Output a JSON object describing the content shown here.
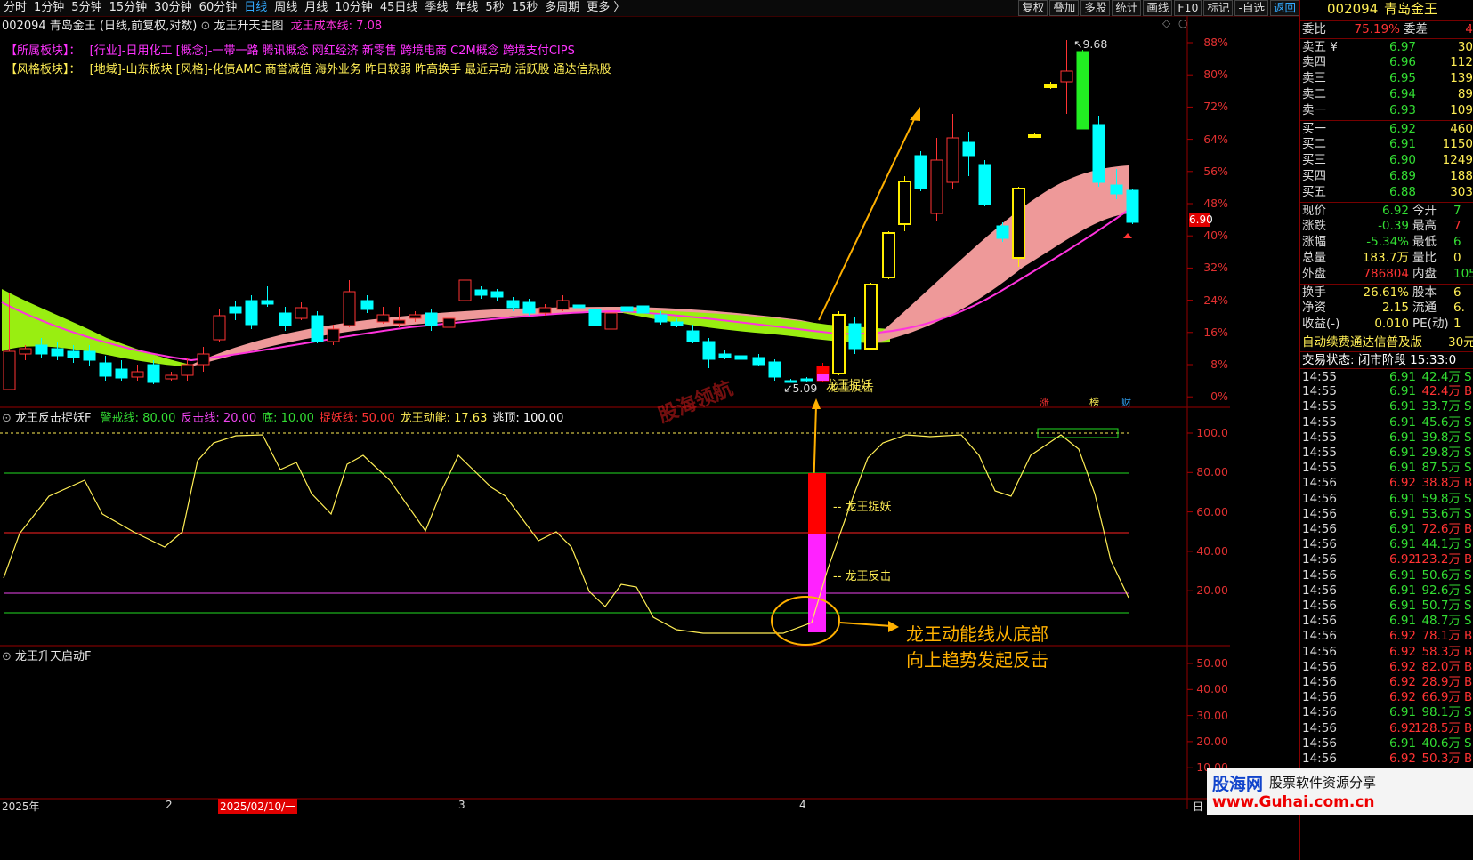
{
  "menubar": {
    "timeframes": [
      "分时",
      "1分钟",
      "5分钟",
      "15分钟",
      "30分钟",
      "60分钟",
      "日线",
      "周线",
      "月线",
      "10分钟",
      "45日线",
      "季线",
      "年线",
      "5秒",
      "15秒",
      "多周期",
      "更多 〉"
    ],
    "active_timeframe": "日线",
    "right_buttons": [
      "复权",
      "叠加",
      "多股",
      "统计",
      "画线",
      "F10",
      "标记",
      "-自选",
      "返回"
    ]
  },
  "main_chart": {
    "header_code": "002094 青岛金王 (日线,前复权,对数)",
    "indicator_name": "龙王升天主图",
    "cost_line_label": "龙王成本线: 7.08",
    "sector_label": "【所属板块】：",
    "sector_text": "[行业]-日用化工 [概念]-一带一路 腾讯概念 网红经济 新零售 跨境电商 C2M概念 跨境支付CIPS",
    "style_label": "【风格板块】：",
    "style_text": "[地域]-山东板块 [风格]-化债AMC 商誉减值 海外业务 昨日较弱 昨高换手 最近异动 活跃股 通达信热股",
    "y_axis": [
      "88%",
      "80%",
      "72%",
      "64%",
      "56%",
      "48%",
      "40%",
      "32%",
      "24%",
      "16%",
      "8%",
      "0%"
    ],
    "price_tag": "6.90",
    "high_label": "9.68",
    "low_label": "5.09",
    "signal_label": "龙王捉妖",
    "signal_label_2": "龙王反击",
    "bottom_badges": [
      "涨",
      "榜",
      "财"
    ]
  },
  "osc_panel": {
    "title": "龙王反击捉妖F",
    "params": [
      {
        "label": "警戒线: 80.00",
        "color": "#33dd33"
      },
      {
        "label": "反击线: 20.00",
        "color": "#ee44ee"
      },
      {
        "label": "底: 10.00",
        "color": "#33dd33"
      },
      {
        "label": "捉妖线: 50.00",
        "color": "#ff3333"
      },
      {
        "label": "龙王动能: 17.63",
        "color": "#ffee55"
      },
      {
        "label": "逃顶: 100.00",
        "color": "#ffffff"
      }
    ],
    "y_axis": [
      "100.0",
      "80.00",
      "60.00",
      "40.00",
      "20.00"
    ],
    "label_catch": "龙王捉妖",
    "label_counter": "龙王反击",
    "annotation_line1": "龙王动能线从底部",
    "annotation_line2": "向上趋势发起反击",
    "watermark": "股海领航"
  },
  "launch_panel": {
    "title": "龙王升天启动F",
    "y_axis": [
      "50.00",
      "40.00",
      "30.00",
      "20.00",
      "10.00"
    ]
  },
  "time_axis": {
    "labels": [
      "2025年",
      "2",
      "2025/02/10/一",
      "3",
      "4"
    ],
    "corner": "日"
  },
  "quote": {
    "code": "002094",
    "name": "青岛金王",
    "weibi_label": "委比",
    "weibi_value": "75.19%",
    "weicha_label": "委差",
    "weicha_value": "4",
    "asks": [
      {
        "label": "卖五 ¥",
        "price": "6.97",
        "vol": "30"
      },
      {
        "label": "卖四",
        "price": "6.96",
        "vol": "112"
      },
      {
        "label": "卖三",
        "price": "6.95",
        "vol": "139"
      },
      {
        "label": "卖二",
        "price": "6.94",
        "vol": "89"
      },
      {
        "label": "卖一",
        "price": "6.93",
        "vol": "109"
      }
    ],
    "bids": [
      {
        "label": "买一",
        "price": "6.92",
        "vol": "460"
      },
      {
        "label": "买二",
        "price": "6.91",
        "vol": "1150"
      },
      {
        "label": "买三",
        "price": "6.90",
        "vol": "1249"
      },
      {
        "label": "买四",
        "price": "6.89",
        "vol": "188"
      },
      {
        "label": "买五",
        "price": "6.88",
        "vol": "303"
      }
    ],
    "stats": [
      {
        "l1": "现价",
        "v1": "6.92",
        "c1": "#33dd33",
        "l2": "今开",
        "v2": "7",
        "c2": "#33dd33"
      },
      {
        "l1": "涨跌",
        "v1": "-0.39",
        "c1": "#33dd33",
        "l2": "最高",
        "v2": "7",
        "c2": "#ff3333"
      },
      {
        "l1": "涨幅",
        "v1": "-5.34%",
        "c1": "#33dd33",
        "l2": "最低",
        "v2": "6",
        "c2": "#33dd33"
      },
      {
        "l1": "总量",
        "v1": "183.7万",
        "c1": "#ffee55",
        "l2": "量比",
        "v2": "0",
        "c2": "#ffee55"
      },
      {
        "l1": "外盘",
        "v1": "786804",
        "c1": "#ff3333",
        "l2": "内盘",
        "v2": "105",
        "c2": "#33dd33"
      },
      {
        "l1": "换手",
        "v1": "26.61%",
        "c1": "#ffee55",
        "l2": "股本",
        "v2": "6",
        "c2": "#ffee55"
      },
      {
        "l1": "净资",
        "v1": "2.15",
        "c1": "#ffee55",
        "l2": "流通",
        "v2": "6.",
        "c2": "#ffee55"
      },
      {
        "l1": "收益(-)",
        "v1": "0.010",
        "c1": "#ffee55",
        "l2": "PE(动)",
        "v2": "1",
        "c2": "#ffee55"
      }
    ],
    "promo": "自动续费通达信普及版",
    "promo_right": "30元",
    "status_line": "交易状态: 闭市阶段 15:33:0",
    "ticks": [
      {
        "t": "14:55",
        "p": "6.91",
        "v": "42.4万",
        "s": "S"
      },
      {
        "t": "14:55",
        "p": "6.91",
        "v": "42.4万",
        "s": "B"
      },
      {
        "t": "14:55",
        "p": "6.91",
        "v": "33.7万",
        "s": "S"
      },
      {
        "t": "14:55",
        "p": "6.91",
        "v": "45.6万",
        "s": "S"
      },
      {
        "t": "14:55",
        "p": "6.91",
        "v": "39.8万",
        "s": "S"
      },
      {
        "t": "14:55",
        "p": "6.91",
        "v": "29.8万",
        "s": "S"
      },
      {
        "t": "14:55",
        "p": "6.91",
        "v": "87.5万",
        "s": "S"
      },
      {
        "t": "14:56",
        "p": "6.92",
        "v": "38.8万",
        "s": "B"
      },
      {
        "t": "14:56",
        "p": "6.91",
        "v": "59.8万",
        "s": "S"
      },
      {
        "t": "14:56",
        "p": "6.91",
        "v": "53.6万",
        "s": "S"
      },
      {
        "t": "14:56",
        "p": "6.91",
        "v": "72.6万",
        "s": "B"
      },
      {
        "t": "14:56",
        "p": "6.91",
        "v": "44.1万",
        "s": "S"
      },
      {
        "t": "14:56",
        "p": "6.92",
        "v": "123.2万",
        "s": "B"
      },
      {
        "t": "14:56",
        "p": "6.91",
        "v": "50.6万",
        "s": "S"
      },
      {
        "t": "14:56",
        "p": "6.91",
        "v": "92.6万",
        "s": "S"
      },
      {
        "t": "14:56",
        "p": "6.91",
        "v": "50.7万",
        "s": "S"
      },
      {
        "t": "14:56",
        "p": "6.91",
        "v": "48.7万",
        "s": "S"
      },
      {
        "t": "14:56",
        "p": "6.92",
        "v": "78.1万",
        "s": "B"
      },
      {
        "t": "14:56",
        "p": "6.92",
        "v": "58.3万",
        "s": "B"
      },
      {
        "t": "14:56",
        "p": "6.92",
        "v": "82.0万",
        "s": "B"
      },
      {
        "t": "14:56",
        "p": "6.92",
        "v": "28.9万",
        "s": "B"
      },
      {
        "t": "14:56",
        "p": "6.92",
        "v": "66.9万",
        "s": "B"
      },
      {
        "t": "14:56",
        "p": "6.91",
        "v": "98.1万",
        "s": "S"
      },
      {
        "t": "14:56",
        "p": "6.92",
        "v": "128.5万",
        "s": "B"
      },
      {
        "t": "14:56",
        "p": "6.91",
        "v": "40.6万",
        "s": "S"
      },
      {
        "t": "14:56",
        "p": "6.92",
        "v": "50.3万",
        "s": "B"
      }
    ]
  },
  "watermark": {
    "brand": "股海网",
    "slogan": "股票软件资源分享",
    "url": "www.Guhai.com.cn"
  },
  "colors": {
    "up": "#ff3333",
    "down": "#00ffff",
    "bull": "#ffee00",
    "bear_ribbon": "#99ee11",
    "bull_ribbon": "#ee9999",
    "ma": "#ff33dd",
    "grid": "#880000",
    "gold": "#ffb000"
  }
}
